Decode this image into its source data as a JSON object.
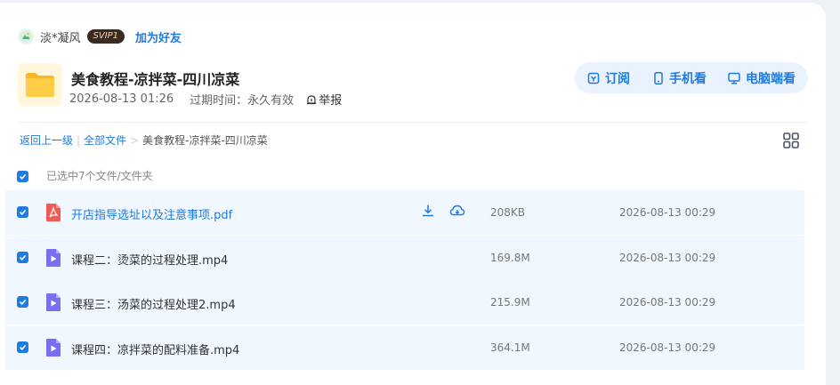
{
  "user": {
    "name": "淡*凝风",
    "vip_badge": "SVIP1",
    "add_friend_label": "加为好友"
  },
  "folder": {
    "title": "美食教程-凉拌菜-四川凉菜",
    "date": "2026-08-13 01:26",
    "expiry_label": "过期时间：",
    "expiry_value": "永久有效",
    "report_label": "举报"
  },
  "actions": {
    "subscribe": "订阅",
    "mobile": "手机看",
    "desktop": "电脑端看"
  },
  "breadcrumb": {
    "back": "返回上一级",
    "all_files": "全部文件",
    "current": "美食教程-凉拌菜-四川凉菜"
  },
  "selection_text": "已选中7个文件/文件夹",
  "files": [
    {
      "name": "开店指导选址以及注意事项.pdf",
      "size": "208KB",
      "date": "2026-08-13 00:29",
      "type": "pdf"
    },
    {
      "name": "课程二：烫菜的过程处理.mp4",
      "size": "169.8M",
      "date": "2026-08-13 00:29",
      "type": "video"
    },
    {
      "name": "课程三：汤菜的过程处理2.mp4",
      "size": "215.9M",
      "date": "2026-08-13 00:29",
      "type": "video"
    },
    {
      "name": "课程四：凉拌菜的配料准备.mp4",
      "size": "364.1M",
      "date": "2026-08-13 00:29",
      "type": "video"
    }
  ],
  "colors": {
    "accent": "#1e7be0",
    "row_bg": "#f0f7fe",
    "action_bg": "#eaf3fd",
    "vip_bg": "#3b2a22",
    "vip_text": "#f3d9b0",
    "pdf_red": "#ee5b56",
    "video_purple": "#7a6ff0",
    "folder_yellow": "#ffc83d"
  }
}
